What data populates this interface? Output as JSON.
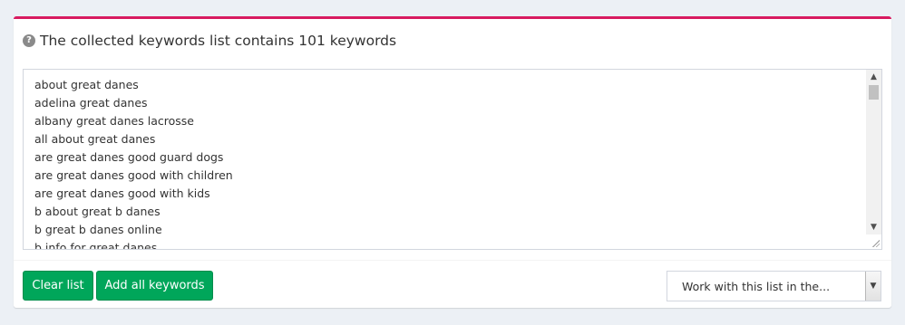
{
  "panel": {
    "title": "The collected keywords list contains 101 keywords",
    "accent_color": "#d81b60",
    "help_icon": "question-circle-icon"
  },
  "keywords": [
    "about great danes",
    "adelina great danes",
    "albany great danes lacrosse",
    "all about great danes",
    "are great danes good guard dogs",
    "are great danes good with children",
    "are great danes good with kids",
    "b about great b danes",
    "b great b danes online",
    "b info for great danes"
  ],
  "buttons": {
    "clear_label": "Clear list",
    "add_all_label": "Add all keywords",
    "color": "#00a65a"
  },
  "work_select": {
    "selected": "Work with this list in the..."
  },
  "icons": {
    "scroll_up": "▲",
    "scroll_down": "▼",
    "select_arrow": "▼",
    "help": "?"
  }
}
